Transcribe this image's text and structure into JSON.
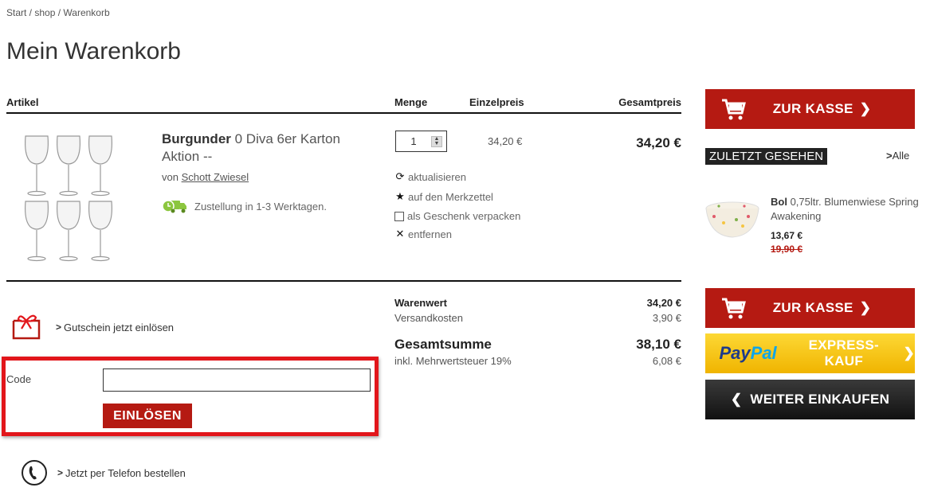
{
  "breadcrumb": [
    "Start",
    "shop",
    "Warenkorb"
  ],
  "page_title": "Mein Warenkorb",
  "table_headers": {
    "article": "Artikel",
    "quantity": "Menge",
    "unit_price": "Einzelpreis",
    "total_price": "Gesamtpreis"
  },
  "item": {
    "name_bold": "Burgunder",
    "name_rest": " 0 Diva 6er Karton Aktion --",
    "brand_prefix": "von",
    "brand": "Schott Zwiesel",
    "delivery": "Zustellung in 1-3 Werktagen.",
    "quantity": "1",
    "unit_price": "34,20 €",
    "total": "34,20 €",
    "actions": {
      "update": "aktualisieren",
      "wishlist": "auf den Merkzettel",
      "gift_wrap": "als Geschenk verpacken",
      "remove": "entfernen"
    }
  },
  "voucher": {
    "link": "Gutschein jetzt einlösen",
    "code_label": "Code",
    "code_value": "",
    "redeem_button": "EINLÖSEN"
  },
  "phone_order": "Jetzt per Telefon bestellen",
  "summary": {
    "goods_label": "Warenwert",
    "goods_value": "34,20 €",
    "shipping_label": "Versandkosten",
    "shipping_value": "3,90 €",
    "total_label": "Gesamtsumme",
    "total_value": "38,10 €",
    "vat_label": "inkl. Mehrwertsteuer 19%",
    "vat_value": "6,08 €"
  },
  "sidebar": {
    "checkout_label": "ZUR KASSE",
    "recently_viewed": "ZULETZT GESEHEN",
    "all_link": "Alle",
    "recent_item": {
      "name_bold": "Bol",
      "name_rest": " 0,75ltr. Blumenwiese Spring Awakening",
      "price": "13,67 €",
      "old_price": "19,90 €"
    },
    "paypal_brand_1": "Pay",
    "paypal_brand_2": "Pal",
    "paypal_label": "EXPRESS-KAUF",
    "continue_label": "WEITER EINKAUFEN"
  },
  "colors": {
    "accent_red": "#b51a12",
    "highlight_red": "#e2161b",
    "paypal_yellow": "#fdd835",
    "delivery_green": "#8cc63f"
  }
}
